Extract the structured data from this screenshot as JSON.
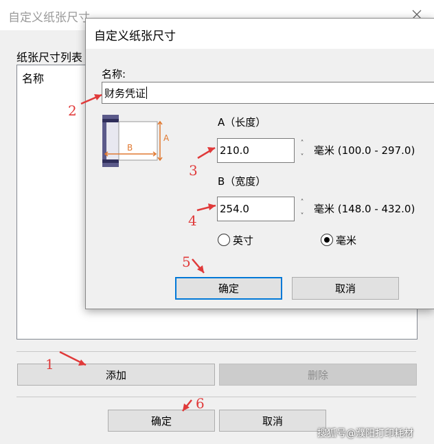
{
  "outer_dialog": {
    "title": "自定义纸张尺寸",
    "list_label": "纸张尺寸列表",
    "list_header": "名称",
    "add_button": "添加",
    "delete_button": "删除",
    "ok_button": "确定",
    "cancel_button": "取消"
  },
  "inner_dialog": {
    "title": "自定义纸张尺寸",
    "name_label": "名称:",
    "name_value": "财务凭证",
    "diagram_label_a": "A",
    "diagram_label_b": "B",
    "a_label": "A（长度）",
    "a_value": "210.0",
    "a_range": "毫米 (100.0 - 297.0)",
    "b_label": "B（宽度）",
    "b_value": "254.0",
    "b_range": "毫米 (148.0 - 432.0)",
    "unit_inch": "英寸",
    "unit_mm": "毫米",
    "selected_unit": "毫米",
    "ok_button": "确定",
    "cancel_button": "取消"
  },
  "annotations": [
    "1",
    "2",
    "3",
    "4",
    "5",
    "6"
  ],
  "watermark": "搜狐号@濮阳打印耗材",
  "colors": {
    "annotation": "#e03a3a",
    "focus": "#0078d7"
  }
}
